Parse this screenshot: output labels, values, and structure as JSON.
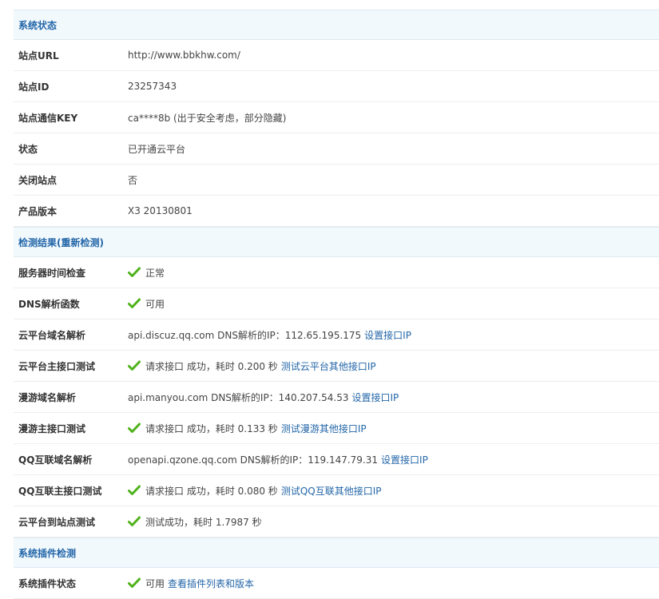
{
  "sections": {
    "status": {
      "title": "系统状态",
      "rows": {
        "site_url": {
          "label": "站点URL",
          "value": "http://www.bbkhw.com/"
        },
        "site_id": {
          "label": "站点ID",
          "value": "23257343"
        },
        "site_key": {
          "label": "站点通信KEY",
          "value": "ca****8b (出于安全考虑，部分隐藏)"
        },
        "state": {
          "label": "状态",
          "value": "已开通云平台"
        },
        "close_site": {
          "label": "关闭站点",
          "value": "否"
        },
        "version": {
          "label": "产品版本",
          "value": "X3 20130801"
        }
      }
    },
    "check": {
      "title": "检测结果(重新检测)",
      "rows": {
        "server_time": {
          "label": "服务器时间检查",
          "value": "正常"
        },
        "dns_func": {
          "label": "DNS解析函数",
          "value": "可用"
        },
        "cloud_domain": {
          "label": "云平台域名解析",
          "value": "api.discuz.qq.com DNS解析的IP：112.65.195.175",
          "link": "设置接口IP"
        },
        "cloud_main": {
          "label": "云平台主接口测试",
          "value": "请求接口 成功，耗时 0.200 秒",
          "link": "测试云平台其他接口IP"
        },
        "manyou_domain": {
          "label": "漫游域名解析",
          "value": "api.manyou.com DNS解析的IP：140.207.54.53",
          "link": "设置接口IP"
        },
        "manyou_main": {
          "label": "漫游主接口测试",
          "value": "请求接口 成功，耗时 0.133 秒",
          "link": "测试漫游其他接口IP"
        },
        "qq_domain": {
          "label": "QQ互联域名解析",
          "value": "openapi.qzone.qq.com DNS解析的IP：119.147.79.31",
          "link": "设置接口IP"
        },
        "qq_main": {
          "label": "QQ互联主接口测试",
          "value": "请求接口 成功，耗时 0.080 秒",
          "link": "测试QQ互联其他接口IP"
        },
        "cloud_to_site": {
          "label": "云平台到站点测试",
          "value": "测试成功，耗时 1.7987 秒"
        }
      }
    },
    "plugin": {
      "title": "系统插件检测",
      "rows": {
        "plugin_status": {
          "label": "系统插件状态",
          "value": "可用",
          "link": "查看插件列表和版本"
        }
      }
    }
  },
  "colors": {
    "header_bg": "#f2f9fd",
    "header_text": "#2366a8",
    "link": "#2366a8",
    "check_green": "#4fb21a"
  },
  "icons": {
    "check": "check-icon"
  }
}
